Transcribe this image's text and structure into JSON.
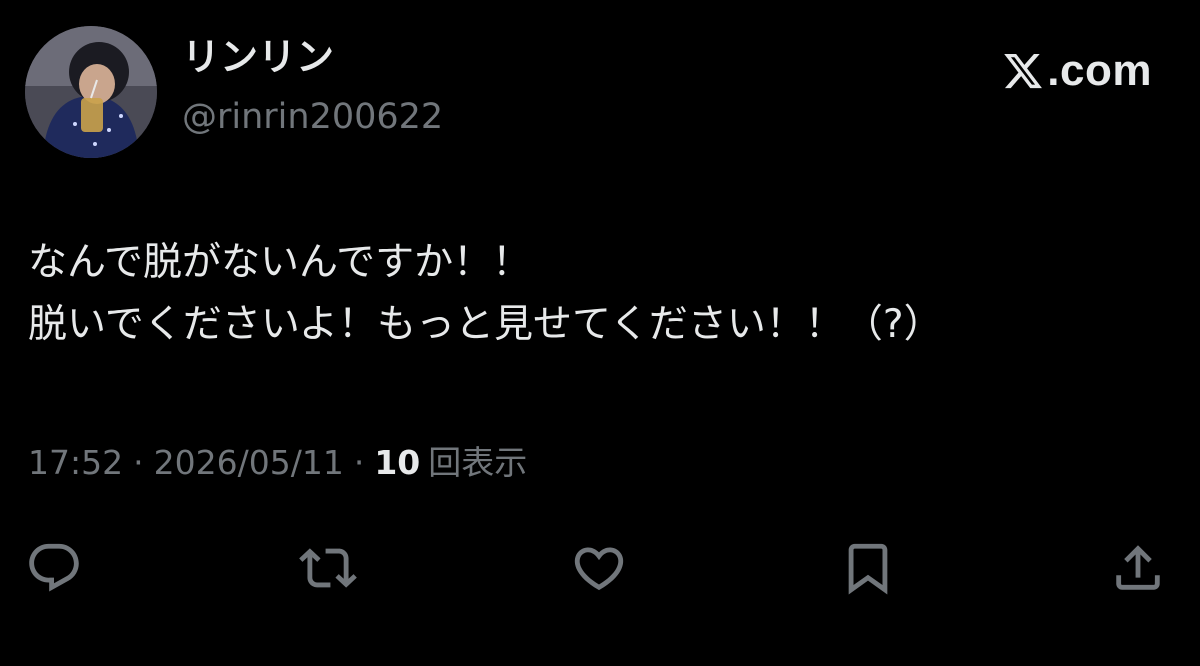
{
  "author": {
    "display_name": "リンリン",
    "handle": "@rinrin200622",
    "avatar": "user-avatar-photo"
  },
  "site": {
    "logo_icon": "x-logo-icon",
    "domain": ".com"
  },
  "tweet": {
    "lines": [
      "なんで脱がないんですか！！",
      "脱いでくださいよ！もっと見せてください！！（?）"
    ],
    "time": "17:52",
    "separator": "·",
    "date": "2026/05/11",
    "views_count": "10",
    "views_label": "回表示"
  },
  "actions": [
    {
      "icon": "reply-icon"
    },
    {
      "icon": "retweet-icon"
    },
    {
      "icon": "like-icon"
    },
    {
      "icon": "bookmark-icon"
    },
    {
      "icon": "share-icon"
    }
  ],
  "colors": {
    "background": "#000000",
    "primary_text": "#e7e9ea",
    "secondary_text": "#71767b"
  }
}
